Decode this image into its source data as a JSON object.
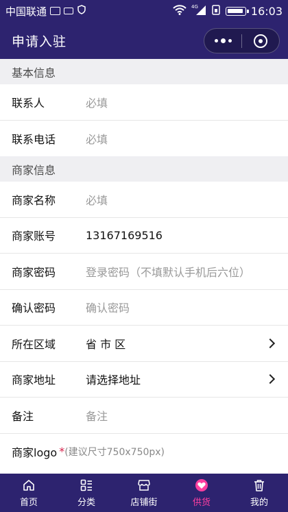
{
  "status_bar": {
    "carrier": "中国联通",
    "network": "4G",
    "time": "16:03"
  },
  "nav": {
    "title": "申请入驻",
    "more_icon": "more-dots-icon",
    "close_icon": "target-circle-icon"
  },
  "sections": [
    {
      "title": "基本信息",
      "fields": [
        {
          "label": "联系人",
          "value": "",
          "placeholder": "必填"
        },
        {
          "label": "联系电话",
          "value": "",
          "placeholder": "必填"
        }
      ]
    },
    {
      "title": "商家信息",
      "fields": [
        {
          "label": "商家名称",
          "value": "",
          "placeholder": "必填"
        },
        {
          "label": "商家账号",
          "value": "13167169516",
          "placeholder": ""
        },
        {
          "label": "商家密码",
          "value": "",
          "placeholder": "登录密码（不填默认手机后六位）"
        },
        {
          "label": "确认密码",
          "value": "",
          "placeholder": "确认密码"
        },
        {
          "label": "所在区域",
          "value": "省 市 区",
          "placeholder": ""
        },
        {
          "label": "商家地址",
          "value": "请选择地址",
          "placeholder": ""
        },
        {
          "label": "备注",
          "value": "",
          "placeholder": "备注"
        }
      ]
    }
  ],
  "logo": {
    "label": "商家logo",
    "required_mark": "*",
    "hint": "(建议尺寸750x750px)"
  },
  "tabbar": {
    "items": [
      {
        "label": "首页",
        "icon": "home-icon"
      },
      {
        "label": "分类",
        "icon": "category-icon"
      },
      {
        "label": "店铺街",
        "icon": "store-icon"
      },
      {
        "label": "供货",
        "icon": "heart-icon"
      },
      {
        "label": "我的",
        "icon": "trash-icon"
      }
    ],
    "active_color": "#ff3fa0"
  },
  "colors": {
    "brand": "#2d236f",
    "section_bg": "#efeff2",
    "required": "#d6204a"
  }
}
